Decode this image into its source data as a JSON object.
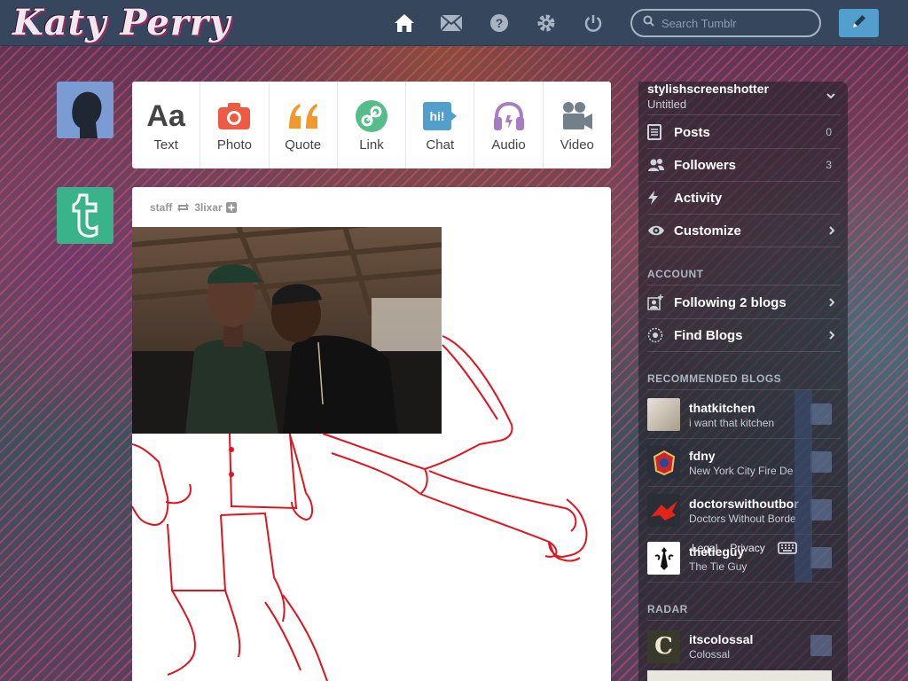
{
  "header": {
    "logo_text": "Katy Perry",
    "search_placeholder": "Search Tumblr",
    "icons": [
      "home-icon",
      "mail-icon",
      "help-icon",
      "gear-icon",
      "power-icon",
      "compose-icon"
    ]
  },
  "post_types": [
    {
      "label": "Text",
      "icon": "text-icon",
      "color": "#444444"
    },
    {
      "label": "Photo",
      "icon": "camera-icon",
      "color": "#ed5b45"
    },
    {
      "label": "Quote",
      "icon": "quote-icon",
      "color": "#f2992e"
    },
    {
      "label": "Link",
      "icon": "link-icon",
      "color": "#56bc8a"
    },
    {
      "label": "Chat",
      "icon": "chat-icon",
      "color": "#529ecc"
    },
    {
      "label": "Audio",
      "icon": "headphones-icon",
      "color": "#a77dc2"
    },
    {
      "label": "Video",
      "icon": "video-camera-icon",
      "color": "#748089"
    }
  ],
  "post": {
    "author": "staff",
    "reblogged_from": "3lixar"
  },
  "sidebar": {
    "blog_name": "stylishscreenshotter",
    "blog_title": "Untitled",
    "menu": [
      {
        "label": "Posts",
        "count": "0"
      },
      {
        "label": "Followers",
        "count": "3"
      },
      {
        "label": "Activity",
        "count": ""
      },
      {
        "label": "Customize",
        "count": ""
      }
    ],
    "account_title": "ACCOUNT",
    "account_items": [
      {
        "label": "Following 2 blogs"
      },
      {
        "label": "Find Blogs"
      }
    ],
    "recommended_title": "RECOMMENDED BLOGS",
    "recommended": [
      {
        "name": "thatkitchen",
        "desc": "i want that kitchen"
      },
      {
        "name": "fdny",
        "desc": "New York City Fire De"
      },
      {
        "name": "doctorswithoutbor",
        "desc": "Doctors Without Borde"
      },
      {
        "name": "thetieguy",
        "desc": "The Tie Guy"
      }
    ],
    "footer": {
      "legal": "Legal",
      "privacy": "Privacy"
    },
    "radar_title": "RADAR",
    "radar": {
      "name": "itscolossal",
      "desc": "Colossal"
    }
  },
  "colors": {
    "header_bg": "#36465d",
    "accent_blue": "#529ecc",
    "tumblr_green": "#3bb38a",
    "sketch_red": "#e0141e"
  }
}
